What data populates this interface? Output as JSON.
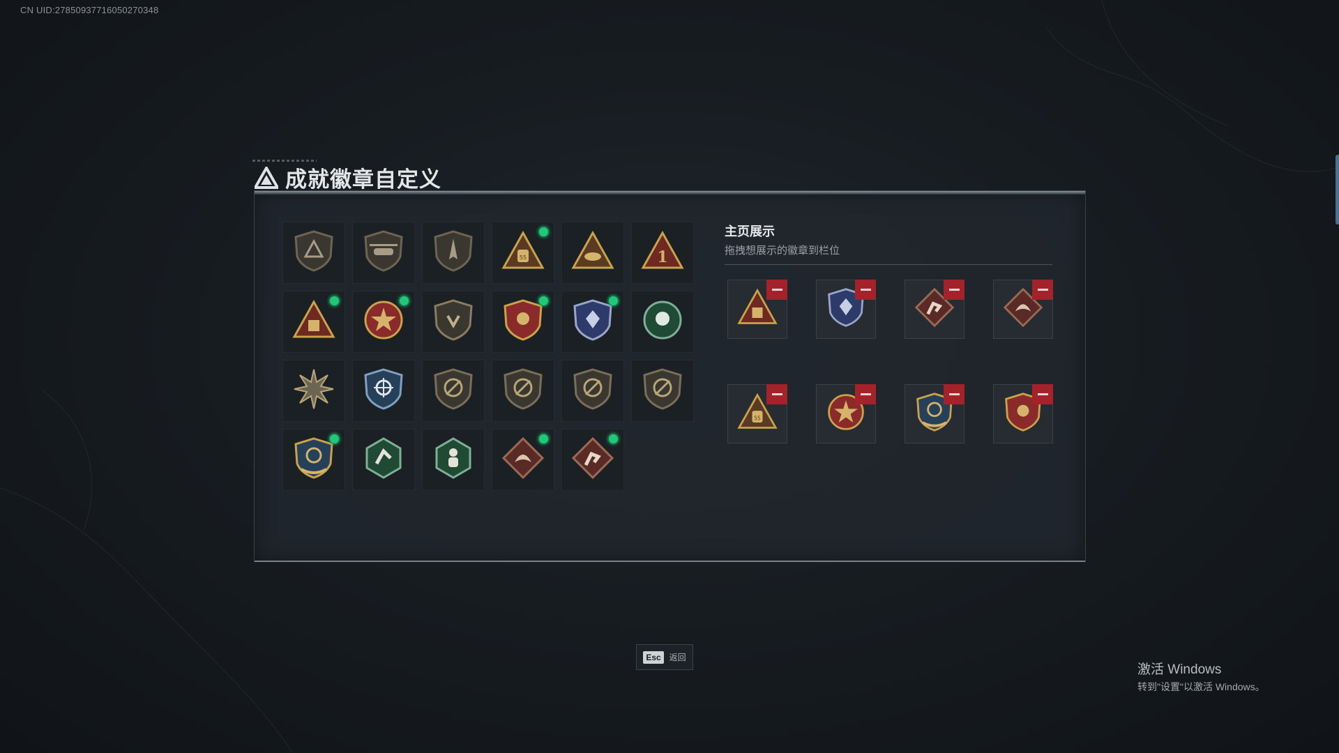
{
  "uid_text": "CN UID:278509377160502703​48",
  "title": "成就徽章自定义",
  "showcase": {
    "title": "主页展示",
    "subtitle": "拖拽想展示的徽章到栏位"
  },
  "esc": {
    "key": "Esc",
    "label": "返回"
  },
  "watermark": {
    "line1": "激活 Windows",
    "line2": "转到\"设置\"以激活 Windows。"
  },
  "colors": {
    "new_dot": "#22c77a",
    "remove_button": "#a4232a",
    "accent_gold": "#c9a24a"
  },
  "badges": [
    {
      "icon": "triangle-logo-shield-badge-icon",
      "new": false
    },
    {
      "icon": "helicopter-shield-badge-icon",
      "new": false
    },
    {
      "icon": "jet-shield-badge-icon",
      "new": false
    },
    {
      "icon": "bag-55-triangle-badge-icon",
      "new": true
    },
    {
      "icon": "bowl-triangle-badge-icon",
      "new": false
    },
    {
      "icon": "number-one-triangle-badge-icon",
      "new": false
    },
    {
      "icon": "box-triangle-badge-icon",
      "new": true
    },
    {
      "icon": "star-emblem-badge-icon",
      "new": true
    },
    {
      "icon": "hands-shield-badge-icon",
      "new": false
    },
    {
      "icon": "red-shield-winged-badge-icon",
      "new": true
    },
    {
      "icon": "blue-shield-winged-badge-icon",
      "new": true
    },
    {
      "icon": "green-rose-medal-badge-icon",
      "new": false
    },
    {
      "icon": "sunburst-medal-badge-icon",
      "new": false
    },
    {
      "icon": "crosshair-shield-badge-icon",
      "new": false
    },
    {
      "icon": "rifle-shield-badge-icon-1",
      "new": false
    },
    {
      "icon": "rifle-shield-badge-icon-2",
      "new": false
    },
    {
      "icon": "rifle-shield-badge-icon-3",
      "new": false
    },
    {
      "icon": "rifle-shield-badge-icon-4",
      "new": false
    },
    {
      "icon": "gold-crest-badge-icon",
      "new": true
    },
    {
      "icon": "green-hex-runner-badge-icon",
      "new": false
    },
    {
      "icon": "green-hex-soldier-badge-icon",
      "new": false
    },
    {
      "icon": "red-diamond-dragon-badge-icon",
      "new": true
    },
    {
      "icon": "red-diamond-runner-badge-icon",
      "new": true
    }
  ],
  "showcase_slots": [
    {
      "icon": "box-triangle-badge-icon"
    },
    {
      "icon": "blue-shield-winged-badge-icon"
    },
    {
      "icon": "red-diamond-runner-badge-icon"
    },
    {
      "icon": "red-diamond-dragon-badge-icon"
    },
    {
      "icon": "bag-55-triangle-badge-icon"
    },
    {
      "icon": "star-emblem-badge-icon"
    },
    {
      "icon": "gold-crest-badge-icon"
    },
    {
      "icon": "red-shield-winged-badge-icon"
    }
  ]
}
